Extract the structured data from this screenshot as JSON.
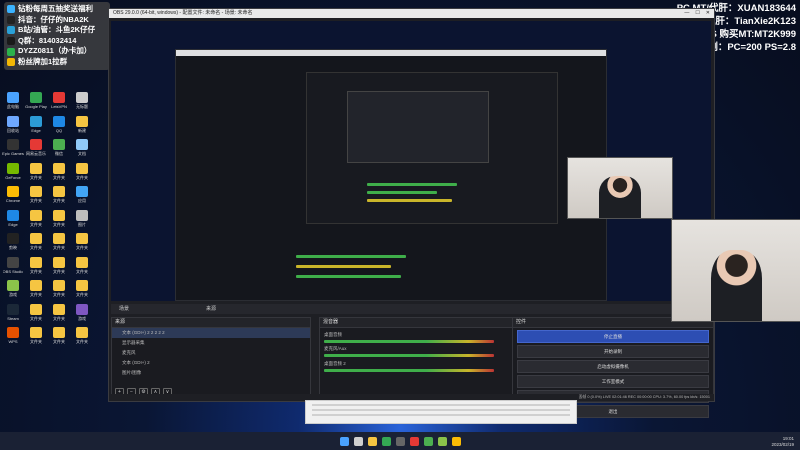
{
  "overlay_left": {
    "lines": [
      {
        "icon": "diamond-icon",
        "color": "#3bb3ff",
        "text": "钻粉每周五抽奖送福利"
      },
      {
        "icon": "tiktok-icon",
        "color": "#222222",
        "text": "抖音：仔仔的NBA2K"
      },
      {
        "icon": "bilibili-icon",
        "color": "#2aa1d8",
        "text": "B站/油管：斗鱼2K仔仔"
      },
      {
        "icon": "qq-icon",
        "color": "#1a1a1a",
        "text": "Q群：814032414"
      },
      {
        "icon": "wechat-icon",
        "color": "#2bb24c",
        "text": "DYZZ0811（办卡加）"
      },
      {
        "icon": "fans-icon",
        "color": "#f2b705",
        "text": "粉丝牌加1拉群"
      }
    ]
  },
  "overlay_right": {
    "lines": [
      "PC MT/代肝：XUAN183644",
      "PS专业代肝：TianXie2K123",
      "PS 购买MT:MT2K999",
      "比例：PC=200 PS=2.8"
    ]
  },
  "obs": {
    "title": "OBS 29.0.0 (64-bit, windows) - 配置文件: 未命名 - 场景: 未命名",
    "window_controls": [
      "—",
      "☐",
      "✕"
    ],
    "dock_tabs": [
      "场景",
      "来源"
    ],
    "panels": {
      "sources_title": "来源",
      "sources": [
        "文本 (GDI+) 2 2 2 2 2",
        "显示器采集",
        "麦克风",
        "文本 (GDI+) 2",
        "图片/图像"
      ],
      "mixer_title": "混音器",
      "mixer_channels": [
        "桌面音频",
        "麦克风/Aux",
        "桌面音频 2"
      ],
      "controls_title": "控件",
      "controls": [
        "停止直播",
        "开始录制",
        "启动虚拟摄像机",
        "工作室模式",
        "设置",
        "退出"
      ]
    },
    "status": "丢帧 0 (0.0%)    LIVE 02:01:46    REC 00:00:00    CPU: 3.7%, 60.00 fps    kb/s: 15001"
  },
  "desktop_icons": [
    {
      "label": "此电脑",
      "color": "#4aa3ff"
    },
    {
      "label": "Google Play",
      "color": "#34a853"
    },
    {
      "label": "LetsVPN",
      "color": "#e53935"
    },
    {
      "label": "无标题",
      "color": "#cccccc"
    },
    {
      "label": "回收站",
      "color": "#6ea8ff"
    },
    {
      "label": "Edge",
      "color": "#2c9bd6"
    },
    {
      "label": "QQ",
      "color": "#1e88e5"
    },
    {
      "label": "新建",
      "color": "#f5c542"
    },
    {
      "label": "Epic Games",
      "color": "#333333"
    },
    {
      "label": "网易云音乐",
      "color": "#e53935"
    },
    {
      "label": "微信",
      "color": "#4caf50"
    },
    {
      "label": "文档",
      "color": "#90caf9"
    },
    {
      "label": "GeForce",
      "color": "#76b900"
    },
    {
      "label": "文件夹",
      "color": "#f5c542"
    },
    {
      "label": "文件夹",
      "color": "#f5c542"
    },
    {
      "label": "文件夹",
      "color": "#f5c542"
    },
    {
      "label": "Chrome",
      "color": "#fbbc05"
    },
    {
      "label": "文件夹",
      "color": "#f5c542"
    },
    {
      "label": "文件夹",
      "color": "#f5c542"
    },
    {
      "label": "应用",
      "color": "#42a5f5"
    },
    {
      "label": "Edge",
      "color": "#1e88e5"
    },
    {
      "label": "文件夹",
      "color": "#f5c542"
    },
    {
      "label": "文件夹",
      "color": "#f5c542"
    },
    {
      "label": "图片",
      "color": "#bdbdbd"
    },
    {
      "label": "剪映",
      "color": "#222222"
    },
    {
      "label": "文件夹",
      "color": "#f5c542"
    },
    {
      "label": "文件夹",
      "color": "#f5c542"
    },
    {
      "label": "文件夹",
      "color": "#f5c542"
    },
    {
      "label": "OBS Studio",
      "color": "#444444"
    },
    {
      "label": "文件夹",
      "color": "#f5c542"
    },
    {
      "label": "文件夹",
      "color": "#f5c542"
    },
    {
      "label": "文件夹",
      "color": "#f5c542"
    },
    {
      "label": "游戏",
      "color": "#8bc34a"
    },
    {
      "label": "文件夹",
      "color": "#f5c542"
    },
    {
      "label": "文件夹",
      "color": "#f5c542"
    },
    {
      "label": "文件夹",
      "color": "#f5c542"
    },
    {
      "label": "Steam",
      "color": "#1b2838"
    },
    {
      "label": "文件夹",
      "color": "#f5c542"
    },
    {
      "label": "文件夹",
      "color": "#f5c542"
    },
    {
      "label": "游戏",
      "color": "#7e57c2"
    },
    {
      "label": "WPS",
      "color": "#e65100"
    },
    {
      "label": "文件夹",
      "color": "#f5c542"
    },
    {
      "label": "文件夹",
      "color": "#f5c542"
    },
    {
      "label": "文件夹",
      "color": "#f5c542"
    }
  ],
  "taskbar": {
    "apps": [
      {
        "name": "windows-icon",
        "color": "#4aa3ff"
      },
      {
        "name": "search-icon",
        "color": "#d0d0d0"
      },
      {
        "name": "folder-icon",
        "color": "#f5c542"
      },
      {
        "name": "chrome-icon",
        "color": "#34a853"
      },
      {
        "name": "obs-icon",
        "color": "#666666"
      },
      {
        "name": "netease-icon",
        "color": "#e53935"
      },
      {
        "name": "wechat-icon",
        "color": "#4caf50"
      },
      {
        "name": "game-icon",
        "color": "#8bc34a"
      },
      {
        "name": "chrome2-icon",
        "color": "#fbbc05"
      }
    ],
    "time": "19:01",
    "date": "2023/02/19"
  }
}
